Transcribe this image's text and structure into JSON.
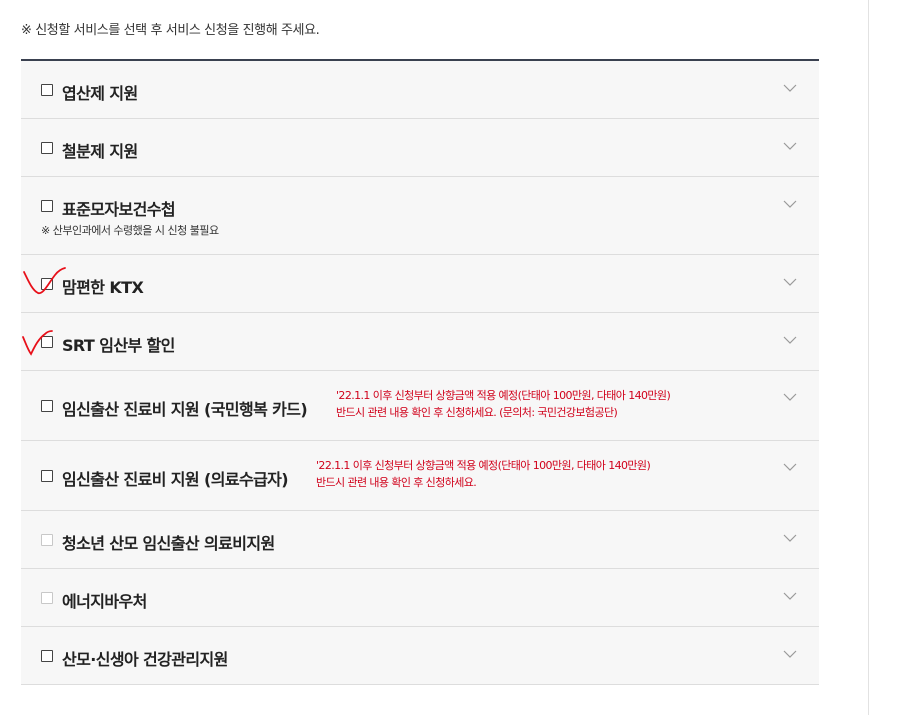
{
  "notice": "※ 신청할 서비스를 선택 후 서비스 신청을 진행해 주세요.",
  "services": [
    {
      "label": "엽산제 지원",
      "checked": false,
      "enabled": true
    },
    {
      "label": "철분제 지원",
      "checked": false,
      "enabled": true
    },
    {
      "label": "표준모자보건수첩",
      "sub": "※ 산부인과에서 수령했을 시 신청 불필요",
      "checked": false,
      "enabled": true
    },
    {
      "label": "맘편한 KTX",
      "checked": false,
      "enabled": true
    },
    {
      "label": "SRT 임산부 할인",
      "checked": false,
      "enabled": true
    },
    {
      "label": "임신출산 진료비 지원 (국민행복 카드)",
      "notes": [
        "'22.1.1 이후 신청부터 상향금액 적용 예정(단태아 100만원, 다태아 140만원)",
        "반드시 관련 내용 확인 후 신청하세요. (문의처: 국민건강보험공단)"
      ],
      "checked": false,
      "enabled": true
    },
    {
      "label": "임신출산 진료비 지원 (의료수급자)",
      "notes": [
        "'22.1.1 이후 신청부터 상향금액 적용 예정(단태아 100만원, 다태아 140만원)",
        "반드시 관련 내용 확인 후 신청하세요."
      ],
      "checked": false,
      "enabled": true
    },
    {
      "label": "청소년 산모 임신출산 의료비지원",
      "checked": false,
      "enabled": false
    },
    {
      "label": "에너지바우처",
      "checked": false,
      "enabled": false
    },
    {
      "label": "산모·신생아 건강관리지원",
      "checked": false,
      "enabled": true
    }
  ],
  "colors": {
    "note": "#d0021b",
    "header_rule": "#3a4150",
    "row_bg": "#f7f7f7",
    "handwritten_mark": "#e8101a"
  },
  "icons": {
    "expand": "chevron-down-icon",
    "mark": "handwritten-check-mark"
  }
}
